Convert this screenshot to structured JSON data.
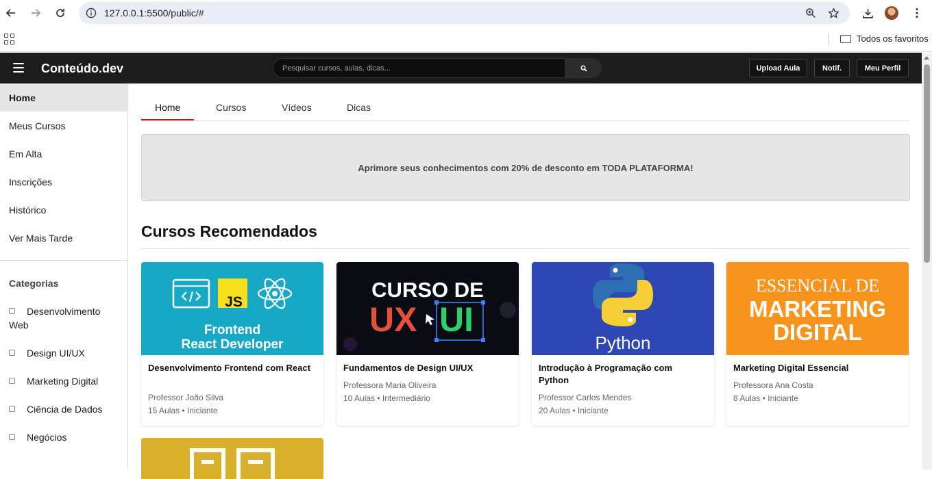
{
  "browser": {
    "url": "127.0.0.1:5500/public/#",
    "bookmark_folder": "Todos os favoritos"
  },
  "header": {
    "brand": "Conteúdo.dev",
    "search_placeholder": "Pesquisar cursos, aulas, dicas...",
    "upload_label": "Upload Aula",
    "notif_label": "Notif.",
    "profile_label": "Meu Perfil"
  },
  "sidebar": {
    "items": [
      {
        "label": "Home"
      },
      {
        "label": "Meus Cursos"
      },
      {
        "label": "Em Alta"
      },
      {
        "label": "Inscrições"
      },
      {
        "label": "Histórico"
      },
      {
        "label": "Ver Mais Tarde"
      }
    ],
    "categories_title": "Categorias",
    "categories": [
      {
        "label": "Desenvolvimento Web"
      },
      {
        "label": "Design UI/UX"
      },
      {
        "label": "Marketing Digital"
      },
      {
        "label": "Ciência de Dados"
      },
      {
        "label": "Negócios"
      }
    ]
  },
  "tabs": [
    {
      "label": "Home"
    },
    {
      "label": "Cursos"
    },
    {
      "label": "Vídeos"
    },
    {
      "label": "Dicas"
    }
  ],
  "promo_text": "Aprimore seus conhecimentos com 20% de desconto em TODA PLATAFORMA!",
  "section_title": "Cursos Recomendados",
  "courses": [
    {
      "thumb_line1": "Frontend",
      "thumb_line2": "React Developer",
      "thumb_js": "JS",
      "title": "Desenvolvimento Frontend com React",
      "teacher": "Professor João Silva",
      "info": "15 Aulas • Iniciante"
    },
    {
      "thumb_line1": "CURSO DE",
      "thumb_ux": "UX",
      "thumb_ui": "UI",
      "title": "Fundamentos de Design UI/UX",
      "teacher": "Professora Maria Oliveira",
      "info": "10 Aulas • Intermediário"
    },
    {
      "thumb_line1": "Python",
      "title": "Introdução à Programação com Python",
      "teacher": "Professor Carlos Mendes",
      "info": "20 Aulas • Iniciante"
    },
    {
      "thumb_line1": "ESSENCIAL DE",
      "thumb_line2": "MARKETING",
      "thumb_line3": "DIGITAL",
      "title": "Marketing Digital Essencial",
      "teacher": "Professora Ana Costa",
      "info": "8 Aulas • Iniciante"
    }
  ],
  "colors": {
    "header_bg": "#1c1c1c",
    "accent_red": "#c1121f",
    "react_bg": "#17a8c6",
    "ux_bg": "#0b0b14",
    "python_bg": "#2e47b5",
    "marketing_bg": "#f7941d",
    "html_bg": "#d9b02c"
  }
}
